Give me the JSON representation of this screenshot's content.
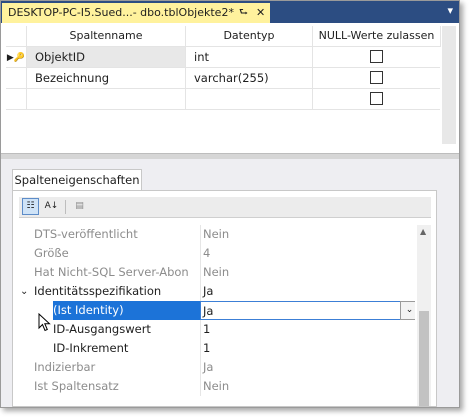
{
  "tab": {
    "title": "DESKTOP-PC-I5.Sued...- dbo.tblObjekte2*",
    "pin_glyph": "⮑",
    "close_glyph": "✕"
  },
  "strip_menu_glyph": "▾",
  "table": {
    "headers": [
      "Spaltenname",
      "Datentyp",
      "NULL-Werte zulassen"
    ],
    "rows": [
      {
        "name": "ObjektID",
        "type": "int",
        "allow_null": false,
        "key": true
      },
      {
        "name": "Bezeichnung",
        "type": "varchar(255)",
        "allow_null": false,
        "key": false
      },
      {
        "name": "",
        "type": "",
        "allow_null": false,
        "key": false
      }
    ],
    "row_marker_glyph": "▶🔑"
  },
  "properties": {
    "tab_label": "Spalteneigenschaften",
    "toolbar": {
      "categorized_glyph": "☷",
      "alphabetical_glyph": "A↓",
      "pages_glyph": "▤"
    },
    "rows": [
      {
        "name": "DTS-veröffentlicht",
        "value": "Nein",
        "dim": true
      },
      {
        "name": "Größe",
        "value": "4",
        "dim": true
      },
      {
        "name": "Hat Nicht-SQL Server-Abon",
        "value": "Nein",
        "dim": true
      },
      {
        "name": "Identitätsspezifikation",
        "value": "Ja",
        "dim": false,
        "expanded": true
      },
      {
        "name": "(Ist Identity)",
        "value": "Ja",
        "dim": false,
        "sub": true,
        "selected": true
      },
      {
        "name": "ID-Ausgangswert",
        "value": "1",
        "dim": false,
        "sub": true
      },
      {
        "name": "ID-Inkrement",
        "value": "1",
        "dim": false,
        "sub": true
      },
      {
        "name": "Indizierbar",
        "value": "Ja",
        "dim": true
      },
      {
        "name": "Ist Spaltensatz",
        "value": "Nein",
        "dim": true
      }
    ],
    "expander_glyph": "⌄",
    "dropdown_glyph": "⌄"
  },
  "colors": {
    "tab_strip": "#2c4d82",
    "active_tab": "#fff29d",
    "selection": "#1c73d8"
  }
}
